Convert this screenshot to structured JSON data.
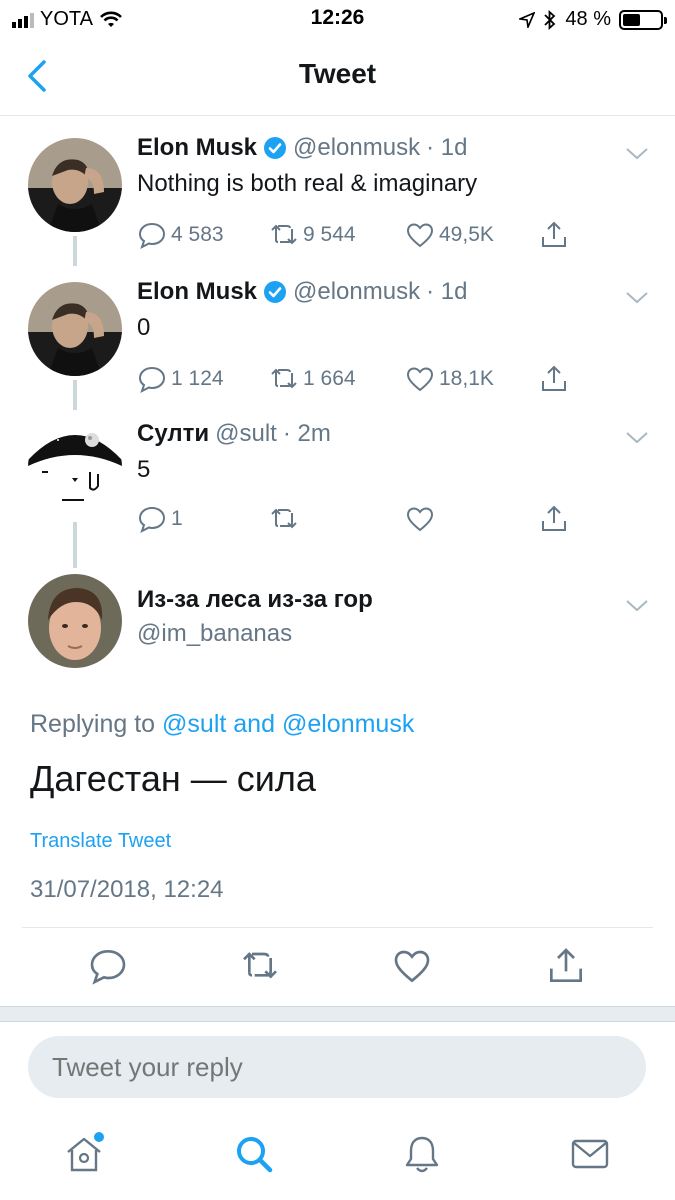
{
  "status_bar": {
    "carrier": "YOTA",
    "time": "12:26",
    "battery": "48 %",
    "battery_level": 0.48
  },
  "nav": {
    "title": "Tweet",
    "back_icon": "chevron-left-icon"
  },
  "thread": [
    {
      "name": "Elon Musk",
      "verified": true,
      "handle": "@elonmusk",
      "time": "· 1d",
      "text": "Nothing is both real & imaginary",
      "replies": "4 583",
      "retweets": "9 544",
      "likes": "49,5K"
    },
    {
      "name": "Elon Musk",
      "verified": true,
      "handle": "@elonmusk",
      "time": "· 1d",
      "text": "0",
      "replies": "1 124",
      "retweets": "1 664",
      "likes": "18,1K"
    },
    {
      "name": "Султи",
      "verified": false,
      "handle": "@sult",
      "time": "· 2m",
      "text": "5",
      "replies": "1",
      "retweets": "",
      "likes": ""
    }
  ],
  "main_tweet": {
    "name": "Из-за леса из-за гор",
    "handle": "@im_bananas",
    "replying_prefix": "Replying to",
    "replying_user1": "@sult",
    "replying_and": "and",
    "replying_user2": "@elonmusk",
    "text": "Дагестан — сила",
    "translate": "Translate Tweet",
    "timestamp": "31/07/2018, 12:24"
  },
  "reply_box": {
    "placeholder": "Tweet your reply"
  },
  "tabbar": {
    "items": [
      "home-icon",
      "search-icon",
      "notifications-icon",
      "messages-icon"
    ]
  },
  "colors": {
    "accent": "#1da1f2",
    "secondary_text": "#657786",
    "border": "#e1e8ed"
  }
}
